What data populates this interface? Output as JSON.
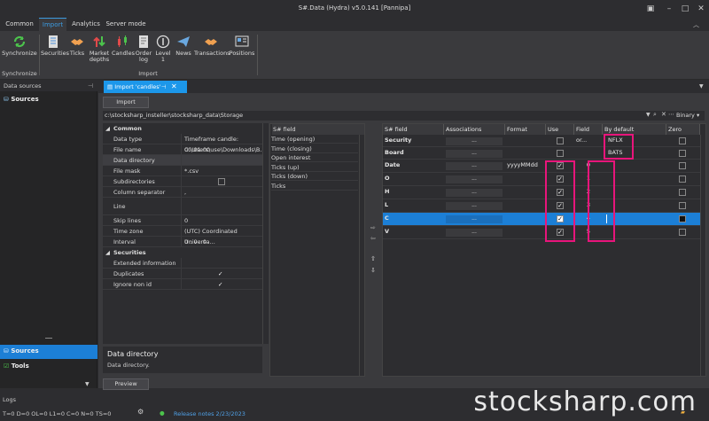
{
  "window": {
    "title": "S#.Data (Hydra) v5.0.141 [Pannipa]"
  },
  "menu": {
    "tabs": [
      "Common",
      "Import",
      "Analytics",
      "Server mode"
    ]
  },
  "ribbon": {
    "sync_label": "Synchronize",
    "sync_group": "Synchronize",
    "import_group": "Import",
    "buttons": [
      "Securities",
      "Ticks",
      "Market depths",
      "Candles",
      "Order log",
      "Level 1",
      "News",
      "Transactions",
      "Positions"
    ]
  },
  "left": {
    "header": "Data sources",
    "sources": "Sources",
    "bottom_sources": "Sources",
    "bottom_tools": "Tools"
  },
  "doc": {
    "tab_title": "Import 'candles'",
    "import_button": "Import",
    "path": "c:\\stocksharp_insteller\\stocksharp_data\\Storage",
    "format": "Binary",
    "preview_button": "Preview"
  },
  "props": {
    "common_header": "Common",
    "rows": [
      {
        "k": "Data type",
        "v": "Timeframe candle: 00:01:00"
      },
      {
        "k": "File name",
        "v": "C:\\Users\\use\\Downloads\\B..."
      },
      {
        "k": "Data directory",
        "v": ""
      },
      {
        "k": "File mask",
        "v": "*.csv"
      },
      {
        "k": "Subdirectories",
        "v": ""
      },
      {
        "k": "Column separator",
        "v": ","
      },
      {
        "k": "Line",
        "v": ""
      },
      {
        "k": "Skip lines",
        "v": "0"
      },
      {
        "k": "Time zone",
        "v": "(UTC) Coordinated Universa..."
      },
      {
        "k": "Interval",
        "v": "0 : 0 : 0"
      }
    ],
    "securities_header": "Securities",
    "sec_rows": [
      {
        "k": "Extended information",
        "v": ""
      },
      {
        "k": "Duplicates",
        "v": "✓"
      },
      {
        "k": "Ignore non id",
        "v": "✓"
      }
    ],
    "desc_title": "Data directory",
    "desc_text": "Data directory."
  },
  "fields_list": {
    "header": "S# field",
    "items": [
      "Time (opening)",
      "Time (closing)",
      "Open interest",
      "Ticks (up)",
      "Ticks (down)",
      "Ticks"
    ]
  },
  "mapping": {
    "headers": [
      "S# field",
      "Associations",
      "Format",
      "Use",
      "Field or...",
      "By default",
      "Zero"
    ],
    "rows": [
      {
        "field": "Security",
        "assoc": "...",
        "format": "",
        "use": false,
        "order": "",
        "def": "NFLX",
        "selected": false
      },
      {
        "field": "Board",
        "assoc": "...",
        "format": "",
        "use": false,
        "order": "",
        "def": "BATS",
        "selected": false
      },
      {
        "field": "Date",
        "assoc": "...",
        "format": "yyyyMMdd",
        "use": true,
        "order": "0",
        "def": "",
        "selected": false
      },
      {
        "field": "O",
        "assoc": "...",
        "format": "",
        "use": true,
        "order": "1",
        "def": "",
        "selected": false
      },
      {
        "field": "H",
        "assoc": "...",
        "format": "",
        "use": true,
        "order": "2",
        "def": "",
        "selected": false
      },
      {
        "field": "L",
        "assoc": "...",
        "format": "",
        "use": true,
        "order": "3",
        "def": "",
        "selected": false
      },
      {
        "field": "C",
        "assoc": "...",
        "format": "",
        "use": true,
        "order": "4",
        "def": "",
        "selected": true
      },
      {
        "field": "V",
        "assoc": "...",
        "format": "",
        "use": true,
        "order": "5",
        "def": "",
        "selected": false
      }
    ]
  },
  "status": {
    "logs": "Logs",
    "counters": "T=0   D=0   OL=0   L1=0   C=0   N=0   TS=0",
    "release": "Release notes 2/23/2023"
  },
  "watermark": "stocksharp.com",
  "colors": {
    "accent": "#1c97ea",
    "highlight": "#e8157b",
    "selected_row": "#1c7fd6"
  }
}
